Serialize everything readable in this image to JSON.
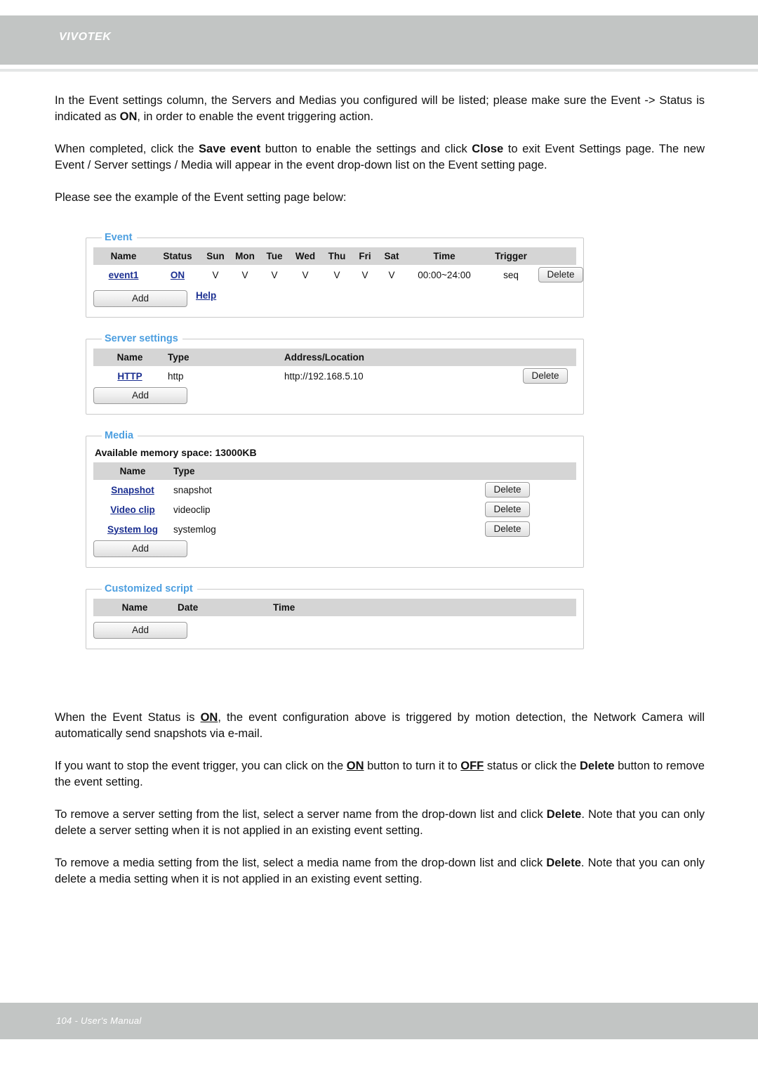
{
  "header": {
    "brand": "VIVOTEK"
  },
  "footer": {
    "folio": "104 - User's Manual"
  },
  "colors": {
    "header_band": "#c2c5c4",
    "legend_blue": "#4d9fe0",
    "link_blue": "#1b2f91",
    "table_header_gray": "#d5d5d5"
  },
  "paragraphs": {
    "p1_a": "In the Event settings column, the Servers and Medias you configured will be listed; please make sure the Event -> Status is indicated as ",
    "p1_on": "ON",
    "p1_b": ", in order to enable the event triggering action.",
    "p2_a": "When completed, click the ",
    "p2_save": "Save event",
    "p2_b": " button to enable the settings and click ",
    "p2_close": "Close",
    "p2_c": " to exit Event Settings page. The new Event / Server settings / Media will appear in the event drop-down list on the Event setting page.",
    "p3": "Please see the example of the Event setting page below:",
    "p4_a": "When the Event Status is ",
    "p4_on": "ON",
    "p4_b": ", the event configuration above is triggered by motion detection, the Network Camera will  automatically send snapshots via e-mail.",
    "p5_a": "If you want to stop the event trigger, you can click on the ",
    "p5_on": "ON",
    "p5_b": " button to turn it to ",
    "p5_off": "OFF",
    "p5_c": " status or click the ",
    "p5_delete": "Delete",
    "p5_d": " button to remove the event setting.",
    "p6_a": "To remove a server setting from the list, select a server name from the drop-down list and click ",
    "p6_delete": "Delete",
    "p6_b": ". Note that you can only delete a server setting when it is not applied in an existing event setting.",
    "p7_a": "To remove a media setting from the list, select a media name from the drop-down list and click ",
    "p7_delete": "Delete",
    "p7_b": ". Note that you can only delete a media setting when it is not applied in an existing event setting."
  },
  "screenshot": {
    "event_panel": {
      "legend": "Event",
      "columns": [
        "Name",
        "Status",
        "Sun",
        "Mon",
        "Tue",
        "Wed",
        "Thu",
        "Fri",
        "Sat",
        "Time",
        "Trigger",
        ""
      ],
      "rows": [
        {
          "name": "event1",
          "status": "ON",
          "sun": "V",
          "mon": "V",
          "tue": "V",
          "wed": "V",
          "thu": "V",
          "fri": "V",
          "sat": "V",
          "time": "00:00~24:00",
          "trigger": "seq",
          "delete_label": "Delete"
        }
      ],
      "add_label": "Add",
      "help_label": "Help"
    },
    "server_panel": {
      "legend": "Server settings",
      "columns": [
        "Name",
        "Type",
        "Address/Location",
        ""
      ],
      "rows": [
        {
          "name": "HTTP",
          "type": "http",
          "address": "http://192.168.5.10",
          "delete_label": "Delete"
        }
      ],
      "add_label": "Add"
    },
    "media_panel": {
      "legend": "Media",
      "memory_line": "Available memory space: 13000KB",
      "columns": [
        "Name",
        "Type",
        ""
      ],
      "rows": [
        {
          "name": "Snapshot",
          "type": "snapshot",
          "delete_label": "Delete"
        },
        {
          "name": "Video clip",
          "type": "videoclip",
          "delete_label": "Delete"
        },
        {
          "name": "System log",
          "type": "systemlog",
          "delete_label": "Delete"
        }
      ],
      "add_label": "Add"
    },
    "script_panel": {
      "legend": "Customized script",
      "columns": [
        "Name",
        "Date",
        "Time",
        ""
      ],
      "rows": [],
      "add_label": "Add"
    }
  }
}
